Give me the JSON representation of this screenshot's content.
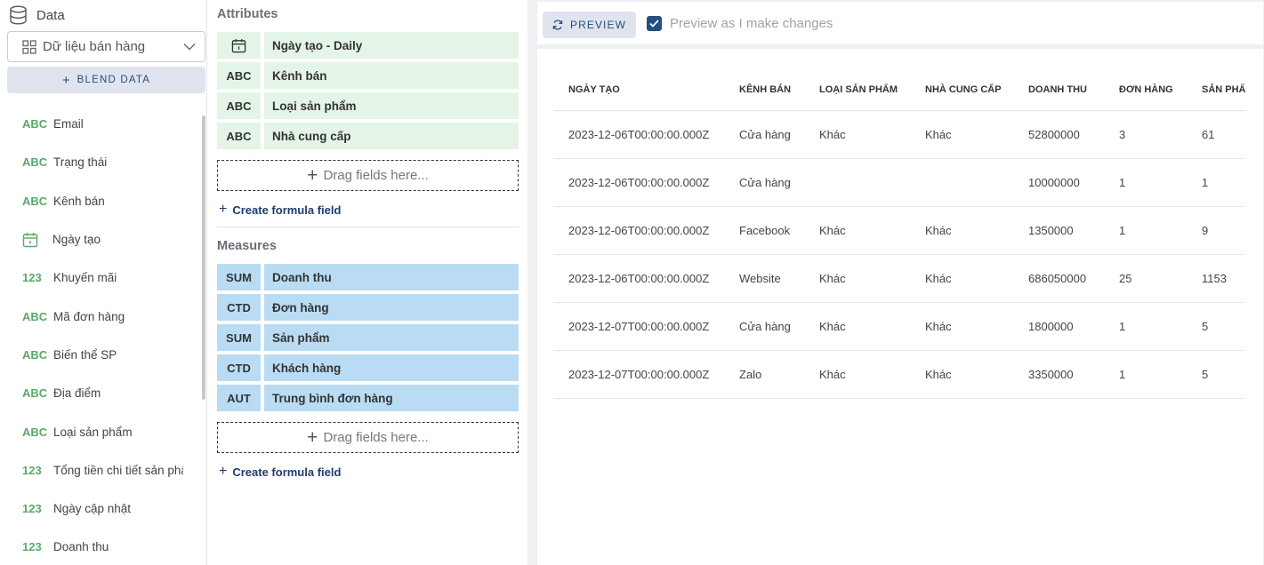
{
  "data_panel": {
    "title": "Data",
    "datasource": "Dữ liệu bán hàng",
    "blend_label": "BLEND DATA",
    "fields": [
      {
        "type": "ABC",
        "name": "Email"
      },
      {
        "type": "ABC",
        "name": "Trạng thái"
      },
      {
        "type": "ABC",
        "name": "Kênh bán"
      },
      {
        "type": "date",
        "name": "Ngày tạo"
      },
      {
        "type": "123",
        "name": "Khuyến mãi"
      },
      {
        "type": "ABC",
        "name": "Mã đơn hàng"
      },
      {
        "type": "ABC",
        "name": "Biến thể SP"
      },
      {
        "type": "ABC",
        "name": "Địa điểm"
      },
      {
        "type": "ABC",
        "name": "Loại sản phẩm"
      },
      {
        "type": "123",
        "name": "Tổng tiền chi tiết sản phẩm"
      },
      {
        "type": "123",
        "name": "Ngày cập nhật"
      },
      {
        "type": "123",
        "name": "Doanh thu"
      }
    ]
  },
  "attributes": {
    "title": "Attributes",
    "items": [
      {
        "tag": "date",
        "name": "Ngày tạo - Daily"
      },
      {
        "tag": "ABC",
        "name": "Kênh bán"
      },
      {
        "tag": "ABC",
        "name": "Loại sản phẩm"
      },
      {
        "tag": "ABC",
        "name": "Nhà cung cấp"
      }
    ],
    "drop_label": "Drag fields here...",
    "formula_label": "Create formula field"
  },
  "measures": {
    "title": "Measures",
    "items": [
      {
        "tag": "SUM",
        "name": "Doanh thu"
      },
      {
        "tag": "CTD",
        "name": "Đơn hàng"
      },
      {
        "tag": "SUM",
        "name": "Sản phẩm"
      },
      {
        "tag": "CTD",
        "name": "Khách hàng"
      },
      {
        "tag": "AUT",
        "name": "Trung bình đơn hàng"
      }
    ],
    "drop_label": "Drag fields here...",
    "formula_label": "Create formula field"
  },
  "preview": {
    "button_label": "PREVIEW",
    "checkbox_label": "Preview as I make changes",
    "checkbox_checked": true,
    "columns": [
      "NGÀY TẠO",
      "KÊNH BÁN",
      "LOẠI SẢN PHẨM",
      "NHÀ CUNG CẤP",
      "DOANH THU",
      "ĐƠN HÀNG",
      "SẢN PHẨM"
    ],
    "rows": [
      [
        "2023-12-06T00:00:00.000Z",
        "Cửa hàng",
        "Khác",
        "Khác",
        "52800000",
        "3",
        "61"
      ],
      [
        "2023-12-06T00:00:00.000Z",
        "Cửa hàng",
        "",
        "",
        "10000000",
        "1",
        "1"
      ],
      [
        "2023-12-06T00:00:00.000Z",
        "Facebook",
        "Khác",
        "Khác",
        "1350000",
        "1",
        "9"
      ],
      [
        "2023-12-06T00:00:00.000Z",
        "Website",
        "Khác",
        "Khác",
        "686050000",
        "25",
        "1153"
      ],
      [
        "2023-12-07T00:00:00.000Z",
        "Cửa hàng",
        "Khác",
        "Khác",
        "1800000",
        "1",
        "5"
      ],
      [
        "2023-12-07T00:00:00.000Z",
        "Zalo",
        "Khác",
        "Khác",
        "3350000",
        "1",
        "5"
      ]
    ]
  },
  "colors": {
    "attribute_pill": "#e4f4e7",
    "measure_pill": "#b9dcf4",
    "accent": "#24507f",
    "field_type": "#5aa86a"
  }
}
